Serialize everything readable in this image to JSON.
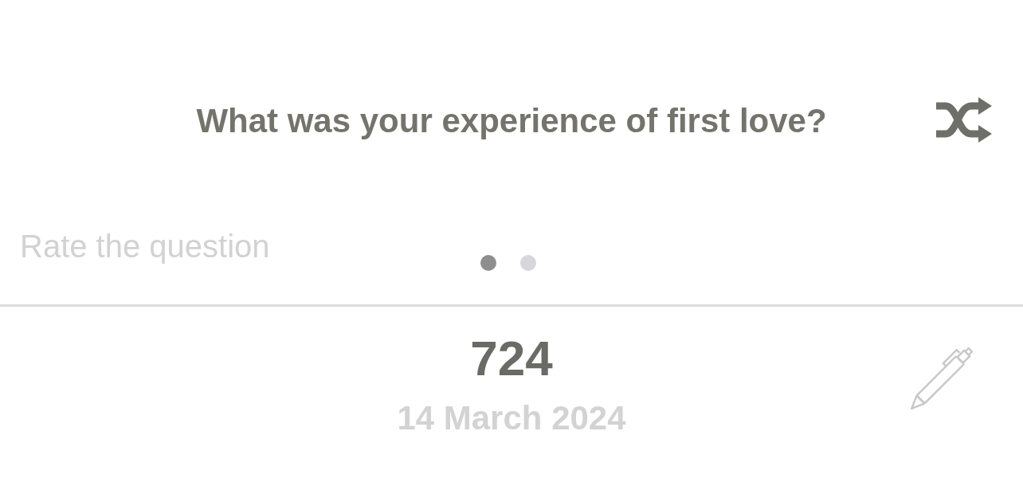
{
  "question": {
    "text": "What was your experience of first love?"
  },
  "rating": {
    "label": "Rate the question"
  },
  "pager": [
    {
      "selected": true
    },
    {
      "selected": false
    }
  ],
  "entry": {
    "number": "724",
    "date": "14 March 2024"
  }
}
